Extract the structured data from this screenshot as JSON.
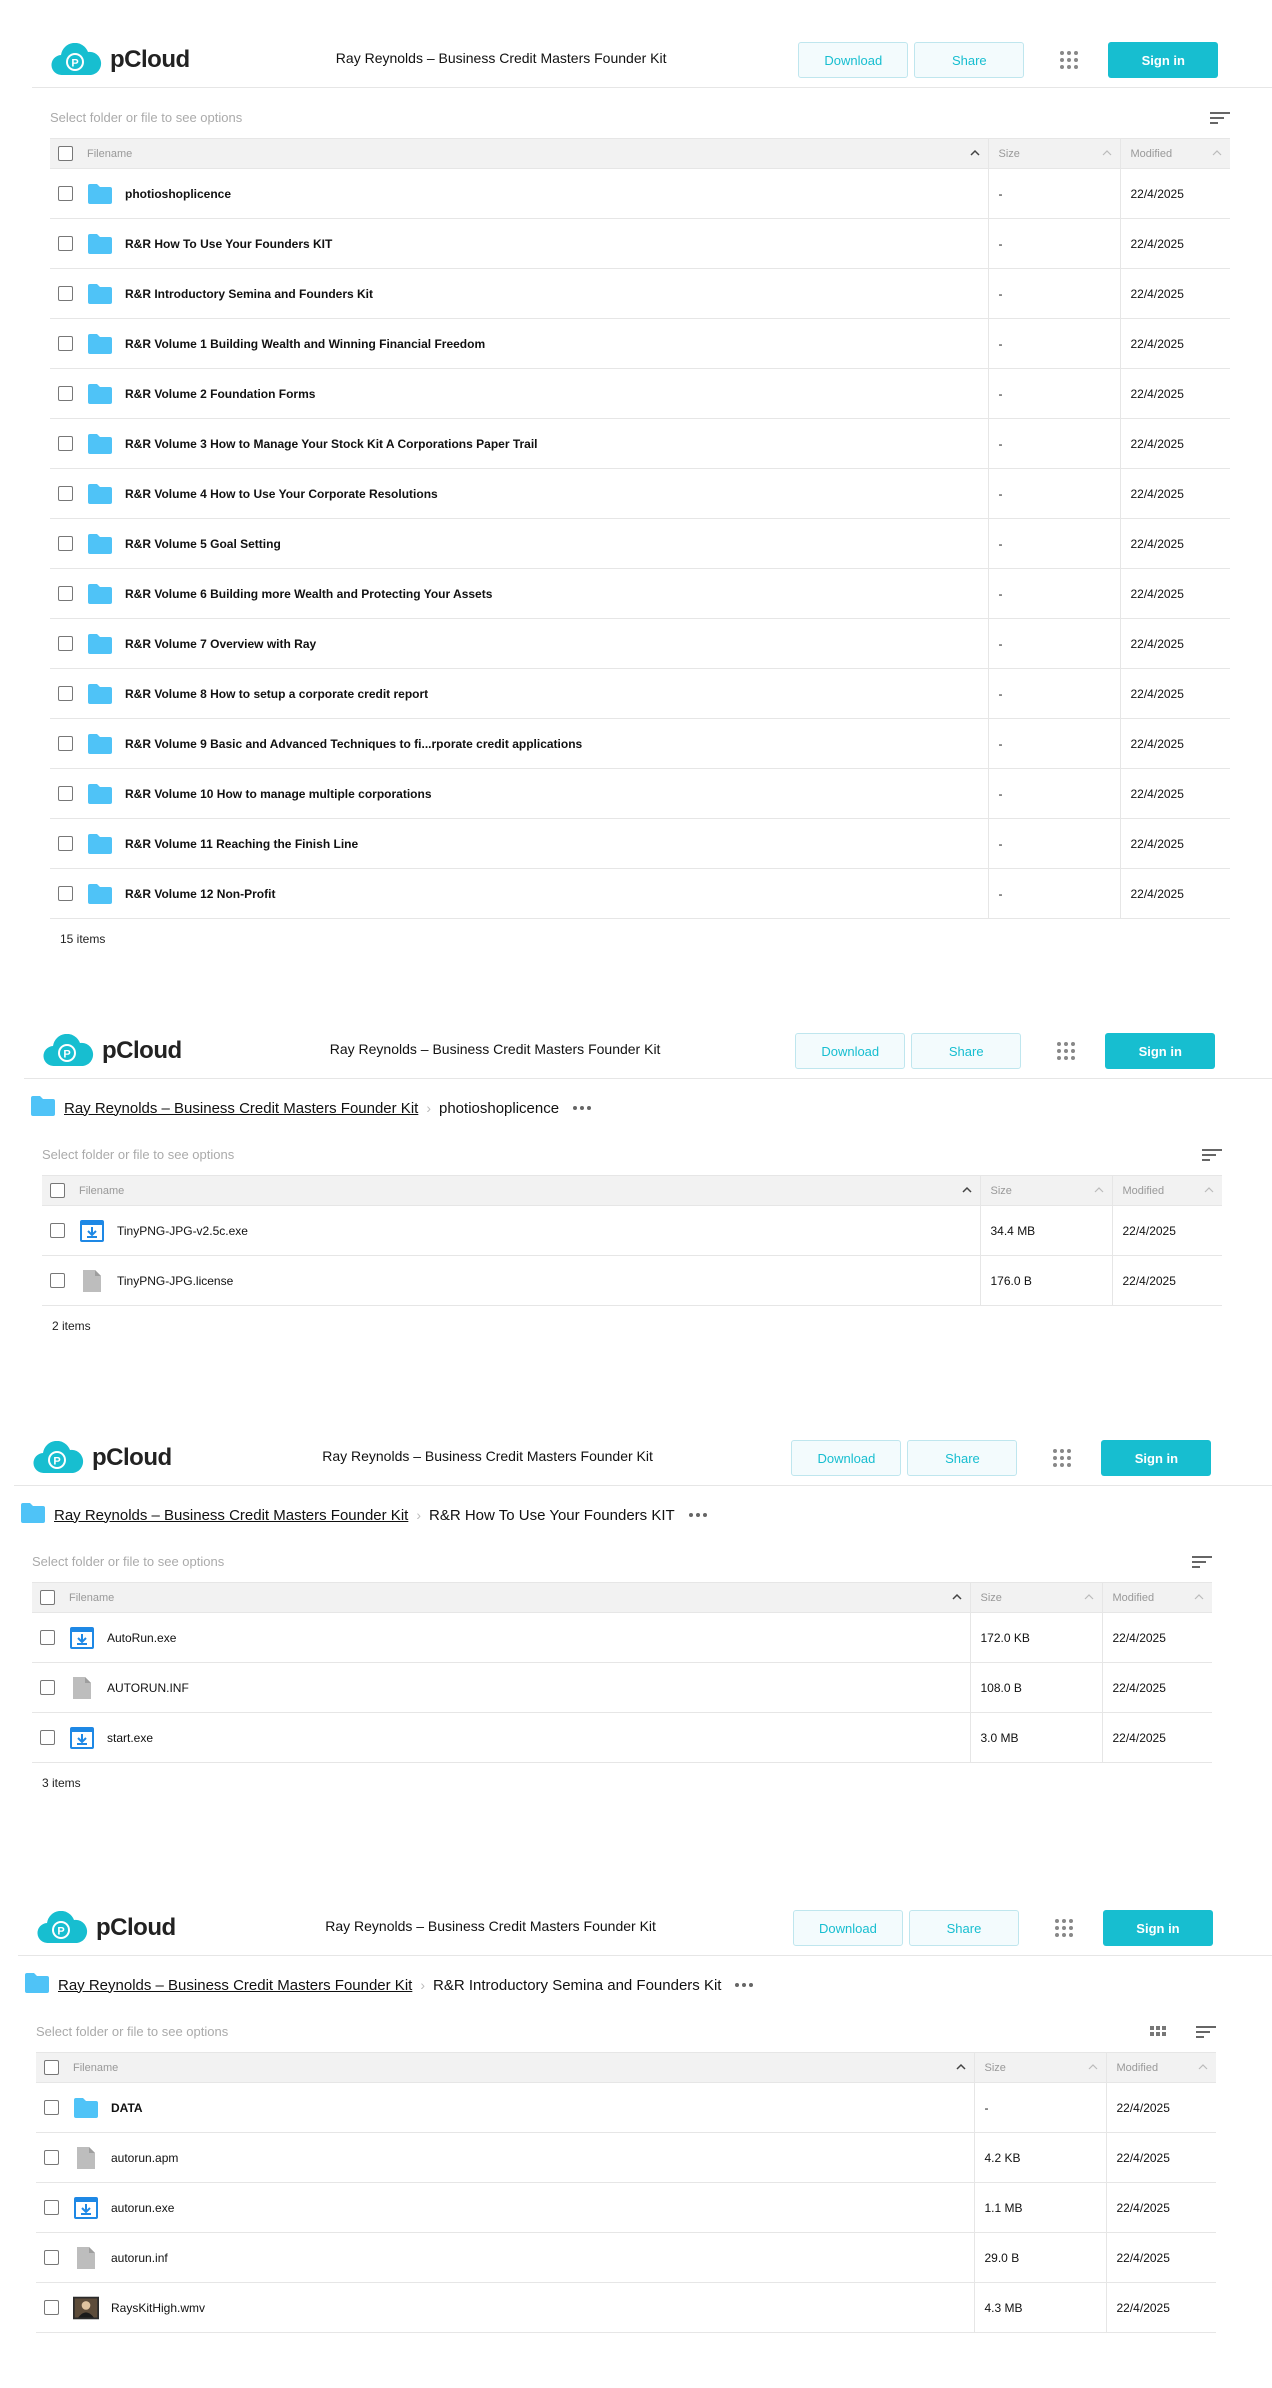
{
  "brand": {
    "name": "pCloud",
    "accent": "#17bed0",
    "folder_color": "#4fc3f7"
  },
  "header": {
    "title": "Ray Reynolds – Business Credit Masters Founder Kit",
    "download": "Download",
    "share": "Share",
    "signin": "Sign in"
  },
  "hint": "Select folder or file to see options",
  "columns": {
    "filename": "Filename",
    "size": "Size",
    "modified": "Modified"
  },
  "panels": [
    {
      "breadcrumb": null,
      "items_count": "15 items",
      "rows": [
        {
          "name": "photioshoplicence",
          "type": "folder",
          "size": "-",
          "modified": "22/4/2025"
        },
        {
          "name": "R&R How To Use Your Founders KIT",
          "type": "folder",
          "size": "-",
          "modified": "22/4/2025"
        },
        {
          "name": "R&R Introductory Semina and Founders Kit",
          "type": "folder",
          "size": "-",
          "modified": "22/4/2025"
        },
        {
          "name": "R&R Volume 1 Building Wealth and Winning Financial Freedom",
          "type": "folder",
          "size": "-",
          "modified": "22/4/2025"
        },
        {
          "name": "R&R Volume 2 Foundation Forms",
          "type": "folder",
          "size": "-",
          "modified": "22/4/2025"
        },
        {
          "name": "R&R Volume 3 How to Manage Your Stock Kit A Corporations Paper Trail",
          "type": "folder",
          "size": "-",
          "modified": "22/4/2025"
        },
        {
          "name": "R&R Volume 4 How to Use Your Corporate Resolutions",
          "type": "folder",
          "size": "-",
          "modified": "22/4/2025"
        },
        {
          "name": "R&R Volume 5 Goal Setting",
          "type": "folder",
          "size": "-",
          "modified": "22/4/2025"
        },
        {
          "name": "R&R Volume 6 Building more Wealth and Protecting Your Assets",
          "type": "folder",
          "size": "-",
          "modified": "22/4/2025"
        },
        {
          "name": "R&R Volume 7 Overview with Ray",
          "type": "folder",
          "size": "-",
          "modified": "22/4/2025"
        },
        {
          "name": "R&R Volume 8 How to setup a corporate credit report",
          "type": "folder",
          "size": "-",
          "modified": "22/4/2025"
        },
        {
          "name": "R&R Volume 9 Basic and Advanced Techniques to fi...rporate credit applications",
          "type": "folder",
          "size": "-",
          "modified": "22/4/2025"
        },
        {
          "name": "R&R Volume 10 How to manage multiple corporations",
          "type": "folder",
          "size": "-",
          "modified": "22/4/2025"
        },
        {
          "name": "R&R Volume 11 Reaching the Finish Line",
          "type": "folder",
          "size": "-",
          "modified": "22/4/2025"
        },
        {
          "name": "R&R Volume 12 Non-Profit",
          "type": "folder",
          "size": "-",
          "modified": "22/4/2025"
        }
      ]
    },
    {
      "breadcrumb": {
        "root": "Ray Reynolds – Business Credit Masters Founder Kit",
        "current": "photioshoplicence"
      },
      "items_count": "2 items",
      "rows": [
        {
          "name": "TinyPNG-JPG-v2.5c.exe",
          "type": "exe",
          "size": "34.4 MB",
          "modified": "22/4/2025"
        },
        {
          "name": "TinyPNG-JPG.license",
          "type": "file",
          "size": "176.0 B",
          "modified": "22/4/2025"
        }
      ]
    },
    {
      "breadcrumb": {
        "root": "Ray Reynolds – Business Credit Masters Founder Kit",
        "current": "R&R How To Use Your Founders KIT"
      },
      "items_count": "3 items",
      "rows": [
        {
          "name": "AutoRun.exe",
          "type": "exe",
          "size": "172.0 KB",
          "modified": "22/4/2025"
        },
        {
          "name": "AUTORUN.INF",
          "type": "file",
          "size": "108.0 B",
          "modified": "22/4/2025"
        },
        {
          "name": "start.exe",
          "type": "exe",
          "size": "3.0 MB",
          "modified": "22/4/2025"
        }
      ]
    },
    {
      "breadcrumb": {
        "root": "Ray Reynolds – Business Credit Masters Founder Kit",
        "current": "R&R Introductory Semina and Founders Kit"
      },
      "items_count": "",
      "rows": [
        {
          "name": "DATA",
          "type": "folder",
          "size": "-",
          "modified": "22/4/2025"
        },
        {
          "name": "autorun.apm",
          "type": "file",
          "size": "4.2 KB",
          "modified": "22/4/2025"
        },
        {
          "name": "autorun.exe",
          "type": "exe",
          "size": "1.1 MB",
          "modified": "22/4/2025"
        },
        {
          "name": "autorun.inf",
          "type": "file",
          "size": "29.0 B",
          "modified": "22/4/2025"
        },
        {
          "name": "RaysKitHigh.wmv",
          "type": "video",
          "size": "4.3 MB",
          "modified": "22/4/2025"
        }
      ]
    }
  ]
}
